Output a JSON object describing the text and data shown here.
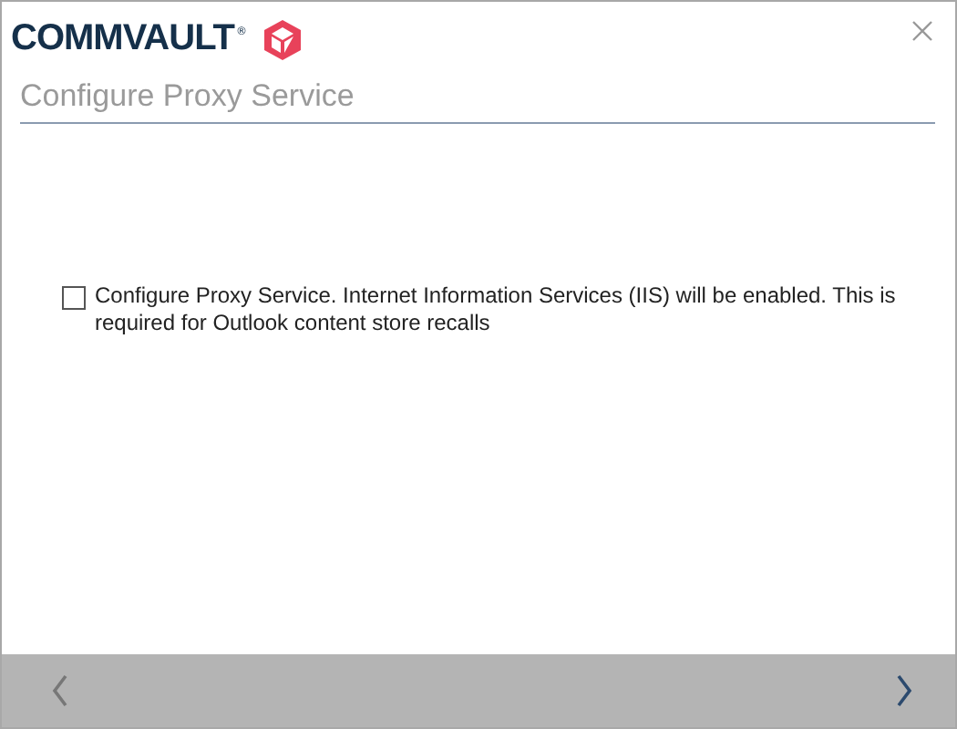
{
  "logo": {
    "text": "COMMVAULT",
    "mark": "®"
  },
  "title": "Configure Proxy Service",
  "option": {
    "label": "Configure Proxy Service. Internet Information Services (IIS) will be enabled. This is required for Outlook content store recalls",
    "checked": false
  },
  "nav": {
    "back_disabled": true,
    "next_disabled": false
  }
}
